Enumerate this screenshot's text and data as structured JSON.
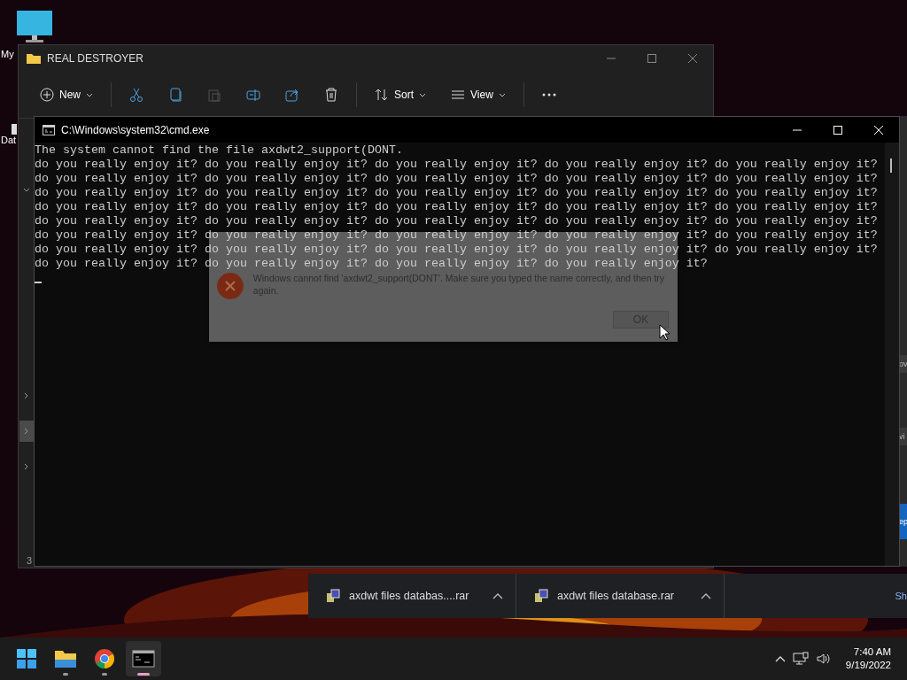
{
  "desktop_icons": [
    {
      "kind": "computer",
      "label": "My"
    },
    {
      "kind": "file",
      "label": "Dat"
    }
  ],
  "explorer_window": {
    "title": "REAL DESTROYER",
    "toolbar": [
      {
        "kind": "new",
        "label": "New",
        "disabled": false
      },
      {
        "kind": "cut",
        "disabled": false
      },
      {
        "kind": "copy",
        "disabled": false
      },
      {
        "kind": "paste",
        "disabled": true
      },
      {
        "kind": "rename",
        "disabled": false
      },
      {
        "kind": "share",
        "disabled": false
      },
      {
        "kind": "delete",
        "disabled": false
      },
      {
        "kind": "sort",
        "label": "Sort",
        "disabled": false
      },
      {
        "kind": "view",
        "label": "View",
        "disabled": false
      },
      {
        "kind": "more",
        "disabled": false
      }
    ],
    "nav_items": [
      {
        "expanded": true,
        "selected": false
      },
      {
        "expanded": false,
        "selected": false
      },
      {
        "expanded": false,
        "selected": true
      },
      {
        "expanded": false,
        "selected": false
      }
    ],
    "footer_text": "3"
  },
  "cmd_window": {
    "title": "C:\\Windows\\system32\\cmd.exe",
    "lines": [
      "The system cannot find the file axdwt2_support(DONT.",
      "do you really enjoy it? do you really enjoy it? do you really enjoy it? do you really enjoy it? do you really enjoy it?",
      "do you really enjoy it? do you really enjoy it? do you really enjoy it? do you really enjoy it? do you really enjoy it?",
      "do you really enjoy it? do you really enjoy it? do you really enjoy it? do you really enjoy it? do you really enjoy it?",
      "do you really enjoy it? do you really enjoy it? do you really enjoy it? do you really enjoy it? do you really enjoy it?",
      "do you really enjoy it? do you really enjoy it? do you really enjoy it? do you really enjoy it? do you really enjoy it?",
      "do you really enjoy it? do you really enjoy it? do you really enjoy it? do you really enjoy it? do you really enjoy it?",
      "do you really enjoy it? do you really enjoy it? do you really enjoy it? do you really enjoy it? do you really enjoy it?",
      "do you really enjoy it? do you really enjoy it? do you really enjoy it? do you really enjoy it?"
    ]
  },
  "error_dialog": {
    "message": "Windows cannot find 'axdwt2_support(DONT'. Make sure you typed the name correctly, and then try again.",
    "button": "OK"
  },
  "background_window": {
    "texts": [
      {
        "kind": "plain",
        "text": "ov"
      },
      {
        "kind": "plain",
        "text": "vi"
      },
      {
        "kind": "button",
        "text": "ep"
      }
    ]
  },
  "downloads": {
    "items": [
      {
        "name": "axdwt files databas....rar"
      },
      {
        "name": "axdwt files database.rar"
      }
    ],
    "show_all": "Sh"
  },
  "taskbar": {
    "apps": [
      {
        "kind": "start",
        "running": false,
        "selected": false
      },
      {
        "kind": "explorer",
        "running": true,
        "selected": false
      },
      {
        "kind": "chrome",
        "running": true,
        "selected": false
      },
      {
        "kind": "terminal",
        "running": true,
        "selected": true
      }
    ],
    "time": "7:40 AM",
    "date": "9/19/2022"
  }
}
